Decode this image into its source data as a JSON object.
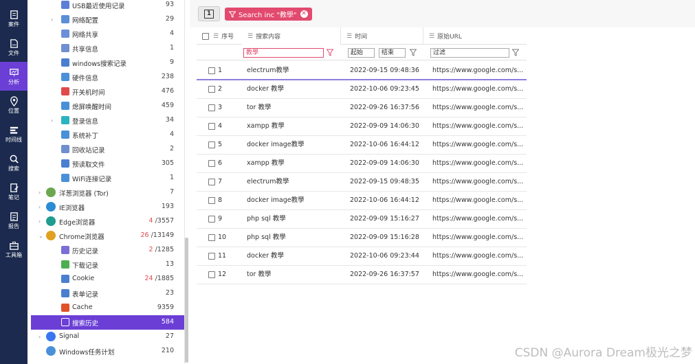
{
  "rail": {
    "items": [
      {
        "label": "案件",
        "icon": "case-icon"
      },
      {
        "label": "文件",
        "icon": "file-icon"
      },
      {
        "label": "分析",
        "icon": "analysis-icon",
        "active": true
      },
      {
        "label": "位置",
        "icon": "location-icon"
      },
      {
        "label": "时间线",
        "icon": "timeline-icon"
      },
      {
        "label": "搜索",
        "icon": "search-icon"
      },
      {
        "label": "笔记",
        "icon": "note-icon"
      },
      {
        "label": "报告",
        "icon": "report-icon"
      },
      {
        "label": "工具箱",
        "icon": "toolbox-icon"
      }
    ]
  },
  "tree": {
    "items": [
      {
        "name": "USB最近使用记录",
        "count": "93",
        "level": 2,
        "icon": "usb-icon",
        "color": "#5b7fd6"
      },
      {
        "name": "网络配置",
        "count": "29",
        "level": 2,
        "arrow": true,
        "icon": "network-config-icon",
        "color": "#5b8fd6"
      },
      {
        "name": "网络共享",
        "count": "4",
        "level": 2,
        "icon": "network-share-icon",
        "color": "#6a8fd6"
      },
      {
        "name": "共享信息",
        "count": "1",
        "level": 2,
        "icon": "share-info-icon",
        "color": "#6f8fcf"
      },
      {
        "name": "windows搜索记录",
        "count": "9",
        "level": 2,
        "icon": "windows-search-icon",
        "color": "#4a7fd0"
      },
      {
        "name": "硬件信息",
        "count": "238",
        "level": 2,
        "icon": "hardware-icon",
        "color": "#4a90d9"
      },
      {
        "name": "开关机时间",
        "count": "476",
        "level": 2,
        "icon": "power-icon",
        "color": "#e04a4a"
      },
      {
        "name": "熄屏唤醒时间",
        "count": "459",
        "level": 2,
        "icon": "screen-wake-icon",
        "color": "#4a90d9"
      },
      {
        "name": "登录信息",
        "count": "34",
        "level": 2,
        "arrow": true,
        "icon": "login-icon",
        "color": "#2bb3c0"
      },
      {
        "name": "系统补丁",
        "count": "4",
        "level": 2,
        "icon": "patch-icon",
        "color": "#4a90d9"
      },
      {
        "name": "回收站记录",
        "count": "2",
        "level": 2,
        "icon": "recycle-bin-icon",
        "color": "#6f8fcf"
      },
      {
        "name": "预读取文件",
        "count": "305",
        "level": 2,
        "icon": "prefetch-icon",
        "color": "#4a7fd0"
      },
      {
        "name": "WiFi连接记录",
        "count": "1",
        "level": 2,
        "icon": "wifi-icon",
        "color": "#4a90d9"
      },
      {
        "name": "洋葱浏览器 (Tor)",
        "count": "7",
        "level": 1,
        "arrow": true,
        "icon": "tor-browser-icon",
        "color": "#6aa84f"
      },
      {
        "name": "IE浏览器",
        "count": "193",
        "level": 1,
        "arrow": true,
        "icon": "ie-browser-icon",
        "color": "#2a8dd4"
      },
      {
        "name": "Edge浏览器",
        "count_hl": "4",
        "count": "/3557",
        "level": 1,
        "arrow": true,
        "icon": "edge-browser-icon",
        "color": "#1f9d8f"
      },
      {
        "name": "Chrome浏览器",
        "count_hl": "26",
        "count": "/13149",
        "level": 1,
        "arrow": true,
        "expanded": true,
        "icon": "chrome-browser-icon",
        "color": "#e0a020"
      },
      {
        "name": "历史记录",
        "count_hl": "2",
        "count": "/1285",
        "level": 2,
        "icon": "history-icon",
        "color": "#7a6fd6"
      },
      {
        "name": "下载记录",
        "count": "13",
        "level": 2,
        "icon": "download-icon",
        "color": "#4caf50"
      },
      {
        "name": "Cookie",
        "count_hl": "24",
        "count": "/1885",
        "level": 2,
        "icon": "cookie-icon",
        "color": "#4a7fd0"
      },
      {
        "name": "表单记录",
        "count": "23",
        "level": 2,
        "icon": "form-icon",
        "color": "#4a7fd0"
      },
      {
        "name": "Cache",
        "count": "9359",
        "level": 2,
        "icon": "cache-icon",
        "color": "#e0522a"
      },
      {
        "name": "搜索历史",
        "count": "584",
        "level": 2,
        "selected": true,
        "icon": "search-history-icon",
        "color": "#ffffff"
      },
      {
        "name": "Signal",
        "count": "27",
        "level": 1,
        "arrow": true,
        "icon": "signal-icon",
        "color": "#3a76f0"
      },
      {
        "name": "Windows任务计划",
        "count": "210",
        "level": 1,
        "icon": "task-scheduler-icon",
        "color": "#4a90d9"
      }
    ]
  },
  "toolbar": {
    "page_label": "1",
    "filter_chip": "Search inc \"教學\"",
    "filter_close": "✕"
  },
  "grid": {
    "columns": {
      "index": "序号",
      "content": "搜索内容",
      "time": "时间",
      "url": "原始URL"
    },
    "filters": {
      "content": "教學",
      "time_start": "起始",
      "time_end": "结束",
      "url": "过滤"
    },
    "rows": [
      {
        "idx": "1",
        "content": "electrum教學",
        "time": "2022-09-15 09:48:36",
        "url": "https://www.google.com/s..."
      },
      {
        "idx": "2",
        "content": "docker 教學",
        "time": "2022-10-06 09:23:45",
        "url": "https://www.google.com/s..."
      },
      {
        "idx": "3",
        "content": "tor 教學",
        "time": "2022-09-26 16:37:56",
        "url": "https://www.google.com/s..."
      },
      {
        "idx": "4",
        "content": "xampp 教學",
        "time": "2022-09-09 14:06:30",
        "url": "https://www.google.com/s..."
      },
      {
        "idx": "5",
        "content": "docker image教學",
        "time": "2022-10-06 16:44:12",
        "url": "https://www.google.com/s..."
      },
      {
        "idx": "6",
        "content": "xampp 教學",
        "time": "2022-09-09 14:06:30",
        "url": "https://www.google.com/s..."
      },
      {
        "idx": "7",
        "content": "electrum教學",
        "time": "2022-09-15 09:48:35",
        "url": "https://www.google.com/s..."
      },
      {
        "idx": "8",
        "content": "docker image教學",
        "time": "2022-10-06 16:44:12",
        "url": "https://www.google.com/s..."
      },
      {
        "idx": "9",
        "content": "php sql 教學",
        "time": "2022-09-09 15:16:27",
        "url": "https://www.google.com/s..."
      },
      {
        "idx": "10",
        "content": "php sql 教學",
        "time": "2022-09-09 15:16:28",
        "url": "https://www.google.com/s..."
      },
      {
        "idx": "11",
        "content": "docker 教學",
        "time": "2022-10-06 09:23:44",
        "url": "https://www.google.com/s..."
      },
      {
        "idx": "12",
        "content": "tor 教學",
        "time": "2022-09-26 16:37:57",
        "url": "https://www.google.com/s..."
      }
    ]
  },
  "watermark": "CSDN @Aurora Dream极光之梦",
  "colors": {
    "rail_bg": "#1b2a4e",
    "accent": "#6b3fd6",
    "filter_chip": "#e24a6e",
    "highlight_count": "#e04a4a"
  }
}
